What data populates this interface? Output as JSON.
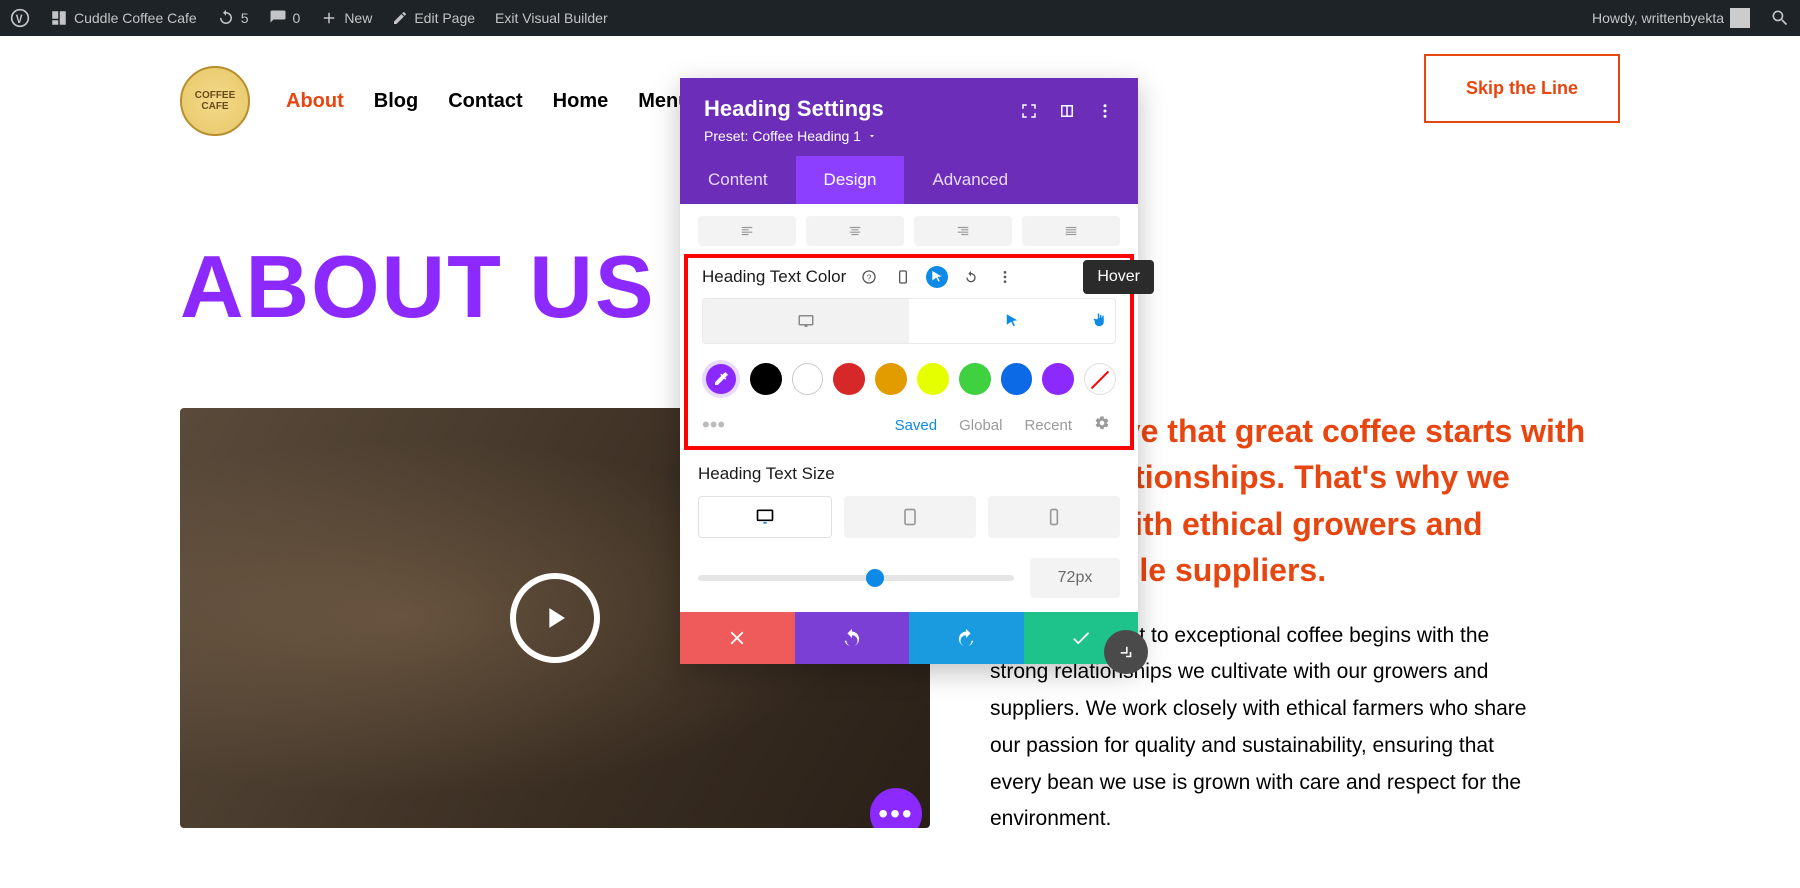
{
  "adminbar": {
    "site": "Cuddle Coffee Cafe",
    "updates": "5",
    "comments": "0",
    "new": "New",
    "edit": "Edit Page",
    "exit": "Exit Visual Builder",
    "howdy": "Howdy, writtenbyekta"
  },
  "nav": {
    "items": [
      "About",
      "Blog",
      "Contact",
      "Home",
      "Menu"
    ],
    "active_index": 0,
    "cta": "Skip the Line"
  },
  "main": {
    "heading": "ABOUT US",
    "highlight": "We Believe that great coffee starts with great relationships. That's why we partner with ethical growers and sustainable suppliers.",
    "body": "Our commitment to exceptional coffee begins with the strong relationships we cultivate with our growers and suppliers. We work closely with ethical farmers who share our passion for quality and sustainability, ensuring that every bean we use is grown with care and respect for the environment."
  },
  "panel": {
    "title": "Heading Settings",
    "preset": "Preset: Coffee Heading 1",
    "tabs": [
      "Content",
      "Design",
      "Advanced"
    ],
    "active_tab": 1,
    "color_label": "Heading Text Color",
    "tooltip": "Hover",
    "swatch_colors": [
      "#000000",
      "#ffffff",
      "#d62828",
      "#e29c00",
      "#e6ff00",
      "#3fd13f",
      "#0d6ae6",
      "#8c29ff"
    ],
    "color_tabs": {
      "saved": "Saved",
      "global": "Global",
      "recent": "Recent"
    },
    "size_label": "Heading Text Size",
    "size_value": "72px"
  }
}
